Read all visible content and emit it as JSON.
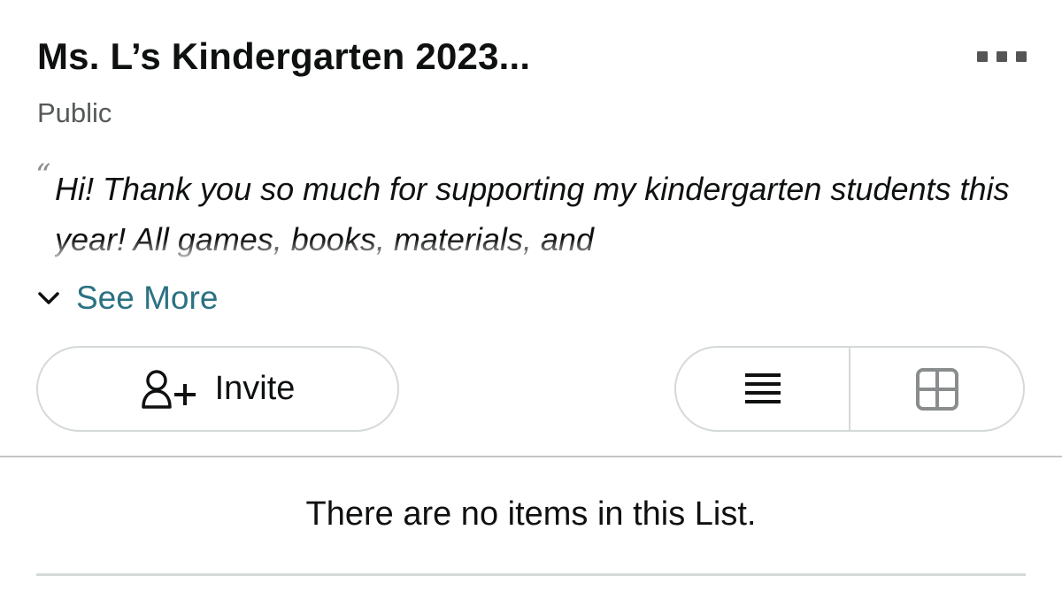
{
  "list": {
    "title": "Ms. L’s Kindergarten 2023...",
    "visibility": "Public",
    "quote_mark": "“",
    "description": "Hi! Thank you so much for supporting my kindergarten students this year! All games, books, materials, and",
    "see_more_label": "See More"
  },
  "actions": {
    "invite_label": "Invite",
    "invite_icon": "add-person-icon",
    "more_icon": "more-options-icon",
    "list_view_icon": "list-view-icon",
    "grid_view_icon": "grid-view-icon",
    "active_view": "list"
  },
  "content": {
    "empty_message": "There are no items in this List."
  },
  "colors": {
    "link": "#2b7283",
    "text": "#0f1111",
    "secondary_text": "#565959",
    "border": "#d5d9d9"
  }
}
